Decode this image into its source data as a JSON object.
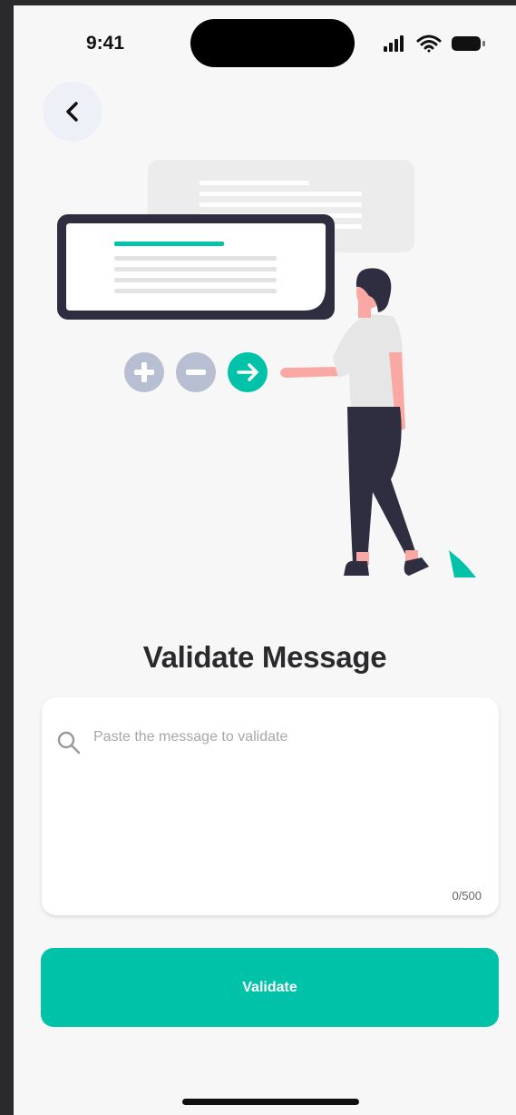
{
  "status_bar": {
    "time": "9:41"
  },
  "page": {
    "title": "Validate Message"
  },
  "message_input": {
    "placeholder": "Paste the message to validate",
    "value": "",
    "counter": "0/500"
  },
  "actions": {
    "validate_label": "Validate"
  },
  "colors": {
    "accent": "#00c2a8",
    "background": "#f7f7f7",
    "card": "#ffffff",
    "title": "#2a2a2c"
  },
  "icons": [
    "back-arrow-icon",
    "search-icon",
    "plus-icon",
    "minus-icon",
    "arrow-right-icon",
    "signal-icon",
    "wifi-icon",
    "battery-icon"
  ]
}
